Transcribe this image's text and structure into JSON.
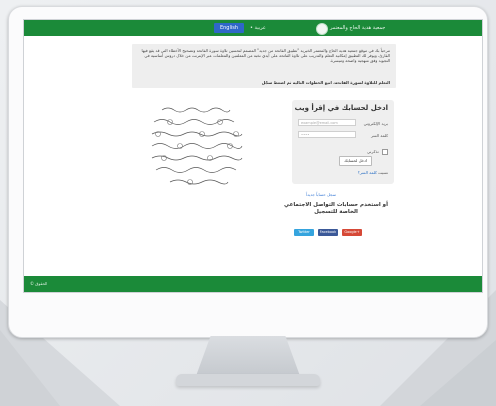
{
  "header": {
    "lang_en": "English",
    "lang_ar": "• عربية",
    "logo_text": "جمعية هدية الحاج والمعتمر"
  },
  "intro": {
    "paragraph": "مرحباً بك في موقع جمعية هدية الحاج والمعتمر الخيرية \"تطبيق الفاتحة من جديد\" المصمم لتحسين تلاوة سورة الفاتحة وتصحيح الأخطاء التي قد يقع فيها القارئ، ويوفر لك التطبيق إمكانية التعلم والتدريب على تلاوة الفاتحة على أيدي نخبة من المعلمين والمعلمات عبر الإنترنت من خلال دروس أساسية في التجويد وفق منهجية واضحة وميسرة.",
    "instruction_prefix": "التعلم للتلاوة لسورة الفاتحة، اتبع الخطوات التالية ثم اضغط",
    "instruction_link": "سجّل"
  },
  "login": {
    "title": "ادخل لحسابك في إقرأ ويب",
    "email_label": "بريد الإلكتروني",
    "email_placeholder": "example@email.com",
    "password_label": "كلمة السر",
    "password_placeholder": "••••",
    "remember_label": "تذكرني",
    "login_button": "ادخل لحسابك",
    "forgot_prefix": "نسيت",
    "forgot_link": "كلمة السر؟"
  },
  "new_account": "سجل حساباً جديداً",
  "social": {
    "title": "أو استخدم حسابات التواصل الاجتماعي الخاصة للتسجيل",
    "twitter": "Twitter",
    "facebook": "Facebook",
    "google": "Google+"
  },
  "quran_image": {
    "label": "سورة الفاتحة"
  },
  "footer": {
    "text": "© الحقوق"
  },
  "colors": {
    "brand_green": "#1b8a39",
    "link_blue": "#2a6fc4",
    "english_button": "#2f67c8",
    "twitter": "#35a4de",
    "facebook": "#3b5998",
    "google": "#d64937"
  }
}
